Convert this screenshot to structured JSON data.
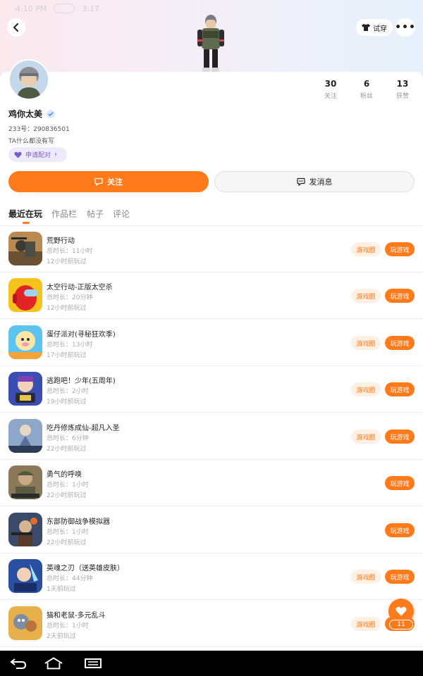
{
  "status_bar": {
    "time": "4:10 PM",
    "extra": "3:17"
  },
  "header": {
    "tryon_label": "试穿",
    "more_label": "•••"
  },
  "profile": {
    "nickname": "鸡你太美",
    "uid": "233号：290836501",
    "bio": "TA什么都没有写",
    "pair_label": "申请配对",
    "stats": [
      {
        "num": "30",
        "label": "关注"
      },
      {
        "num": "6",
        "label": "粉丝"
      },
      {
        "num": "13",
        "label": "获赞"
      }
    ]
  },
  "actions": {
    "follow": "关注",
    "message": "发消息"
  },
  "tabs": [
    {
      "label": "最近在玩",
      "active": true
    },
    {
      "label": "作品栏",
      "active": false
    },
    {
      "label": "帖子",
      "active": false
    },
    {
      "label": "评论",
      "active": false
    }
  ],
  "games": [
    {
      "name": "荒野行动",
      "duration": "总时长：11小时",
      "last": "12小时前玩过",
      "circle": "游戏圈",
      "play": "玩游戏"
    },
    {
      "name": "太空行动-正版太空杀",
      "duration": "总时长：20分钟",
      "last": "12小时前玩过",
      "circle": "游戏圈",
      "play": "玩游戏"
    },
    {
      "name": "蛋仔派对(寻秘狂欢季)",
      "duration": "总时长：13小时",
      "last": "17小时前玩过",
      "circle": "游戏圈",
      "play": "玩游戏"
    },
    {
      "name": "逃跑吧！少年(五周年)",
      "duration": "总时长：2小时",
      "last": "19小时前玩过",
      "circle": "游戏圈",
      "play": "玩游戏"
    },
    {
      "name": "吃丹修炼成仙-超凡入圣",
      "duration": "总时长：6分钟",
      "last": "22小时前玩过",
      "circle": "游戏圈",
      "play": "玩游戏"
    },
    {
      "name": "勇气的呼唤",
      "duration": "总时长：1小时",
      "last": "22小时前玩过",
      "circle": "",
      "play": "玩游戏"
    },
    {
      "name": "东部防御战争模拟器",
      "duration": "总时长：1小时",
      "last": "22小时前玩过",
      "circle": "",
      "play": "玩游戏"
    },
    {
      "name": "英魂之刃（送英雄皮肤）",
      "duration": "总时长：44分钟",
      "last": "1天前玩过",
      "circle": "游戏圈",
      "play": "玩游戏"
    },
    {
      "name": "猫和老鼠-多元乱斗",
      "duration": "总时长：1小时",
      "last": "2天前玩过",
      "circle": "游戏圈",
      "play": "玩游戏"
    }
  ],
  "float": {
    "count": "11"
  },
  "colors": {
    "accent": "#ff7a1a",
    "pair": "#7b5cc9"
  }
}
